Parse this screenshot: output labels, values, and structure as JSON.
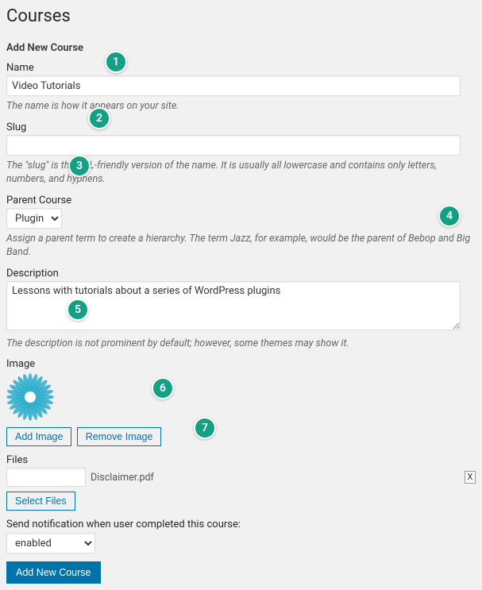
{
  "page": {
    "title": "Courses"
  },
  "form": {
    "heading": "Add New Course",
    "name": {
      "label": "Name",
      "value": "Video Tutorials",
      "help": "The name is how it appears on your site."
    },
    "slug": {
      "label": "Slug",
      "value": "",
      "help": "The \"slug\" is the URL-friendly version of the name. It is usually all lowercase and contains only letters, numbers, and hyphens."
    },
    "parent": {
      "label": "Parent Course",
      "selected": "Plugins",
      "help": "Assign a parent term to create a hierarchy. The term Jazz, for example, would be the parent of Bebop and Big Band."
    },
    "description": {
      "label": "Description",
      "value": "Lessons with tutorials about a series of WordPress plugins",
      "help": "The description is not prominent by default; however, some themes may show it."
    },
    "image": {
      "label": "Image",
      "add_button": "Add Image",
      "remove_button": "Remove Image"
    },
    "files": {
      "label": "Files",
      "filename": "Disclaimer.pdf",
      "select_button": "Select Files",
      "remove_x": "X"
    },
    "notification": {
      "label": "Send notification when user completed this course:",
      "selected": "enabled"
    },
    "submit": "Add New Course"
  },
  "markers": [
    "1",
    "2",
    "3",
    "4",
    "5",
    "6",
    "7"
  ]
}
